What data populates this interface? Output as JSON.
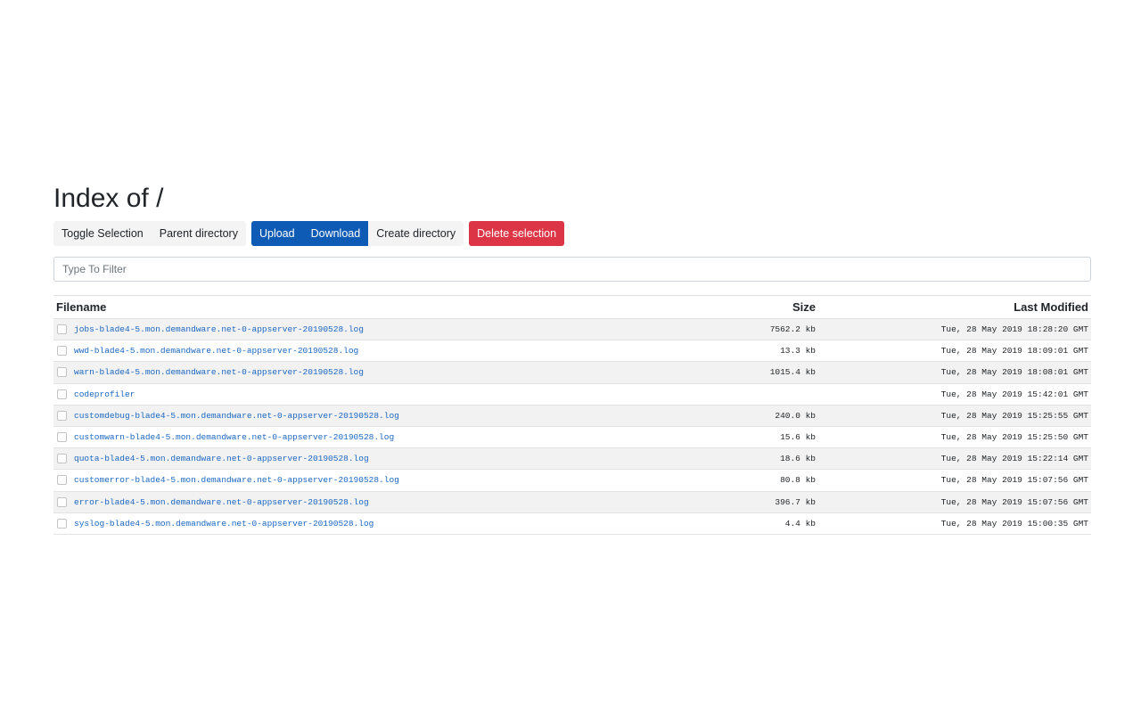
{
  "page": {
    "title": "Index of /"
  },
  "toolbar": {
    "toggle_selection": "Toggle Selection",
    "parent_directory": "Parent directory",
    "upload": "Upload",
    "download": "Download",
    "create_directory": "Create directory",
    "delete_selection": "Delete selection"
  },
  "filter": {
    "placeholder": "Type To Filter",
    "value": ""
  },
  "table": {
    "headers": {
      "filename": "Filename",
      "size": "Size",
      "modified": "Last Modified"
    },
    "rows": [
      {
        "name": "jobs-blade4-5.mon.demandware.net-0-appserver-20190528.log",
        "size": "7562.2 kb",
        "modified": "Tue, 28 May 2019 18:28:20 GMT"
      },
      {
        "name": "wwd-blade4-5.mon.demandware.net-0-appserver-20190528.log",
        "size": "13.3 kb",
        "modified": "Tue, 28 May 2019 18:09:01 GMT"
      },
      {
        "name": "warn-blade4-5.mon.demandware.net-0-appserver-20190528.log",
        "size": "1015.4 kb",
        "modified": "Tue, 28 May 2019 18:08:01 GMT"
      },
      {
        "name": "codeprofiler",
        "size": "",
        "modified": "Tue, 28 May 2019 15:42:01 GMT"
      },
      {
        "name": "customdebug-blade4-5.mon.demandware.net-0-appserver-20190528.log",
        "size": "240.0 kb",
        "modified": "Tue, 28 May 2019 15:25:55 GMT"
      },
      {
        "name": "customwarn-blade4-5.mon.demandware.net-0-appserver-20190528.log",
        "size": "15.6 kb",
        "modified": "Tue, 28 May 2019 15:25:50 GMT"
      },
      {
        "name": "quota-blade4-5.mon.demandware.net-0-appserver-20190528.log",
        "size": "18.6 kb",
        "modified": "Tue, 28 May 2019 15:22:14 GMT"
      },
      {
        "name": "customerror-blade4-5.mon.demandware.net-0-appserver-20190528.log",
        "size": "80.8 kb",
        "modified": "Tue, 28 May 2019 15:07:56 GMT"
      },
      {
        "name": "error-blade4-5.mon.demandware.net-0-appserver-20190528.log",
        "size": "396.7 kb",
        "modified": "Tue, 28 May 2019 15:07:56 GMT"
      },
      {
        "name": "syslog-blade4-5.mon.demandware.net-0-appserver-20190528.log",
        "size": "4.4 kb",
        "modified": "Tue, 28 May 2019 15:00:35 GMT"
      }
    ]
  },
  "colors": {
    "primary": "#0d5bb5",
    "danger": "#dc3545",
    "link": "#1a66c2",
    "row_stripe": "#f2f2f2"
  }
}
